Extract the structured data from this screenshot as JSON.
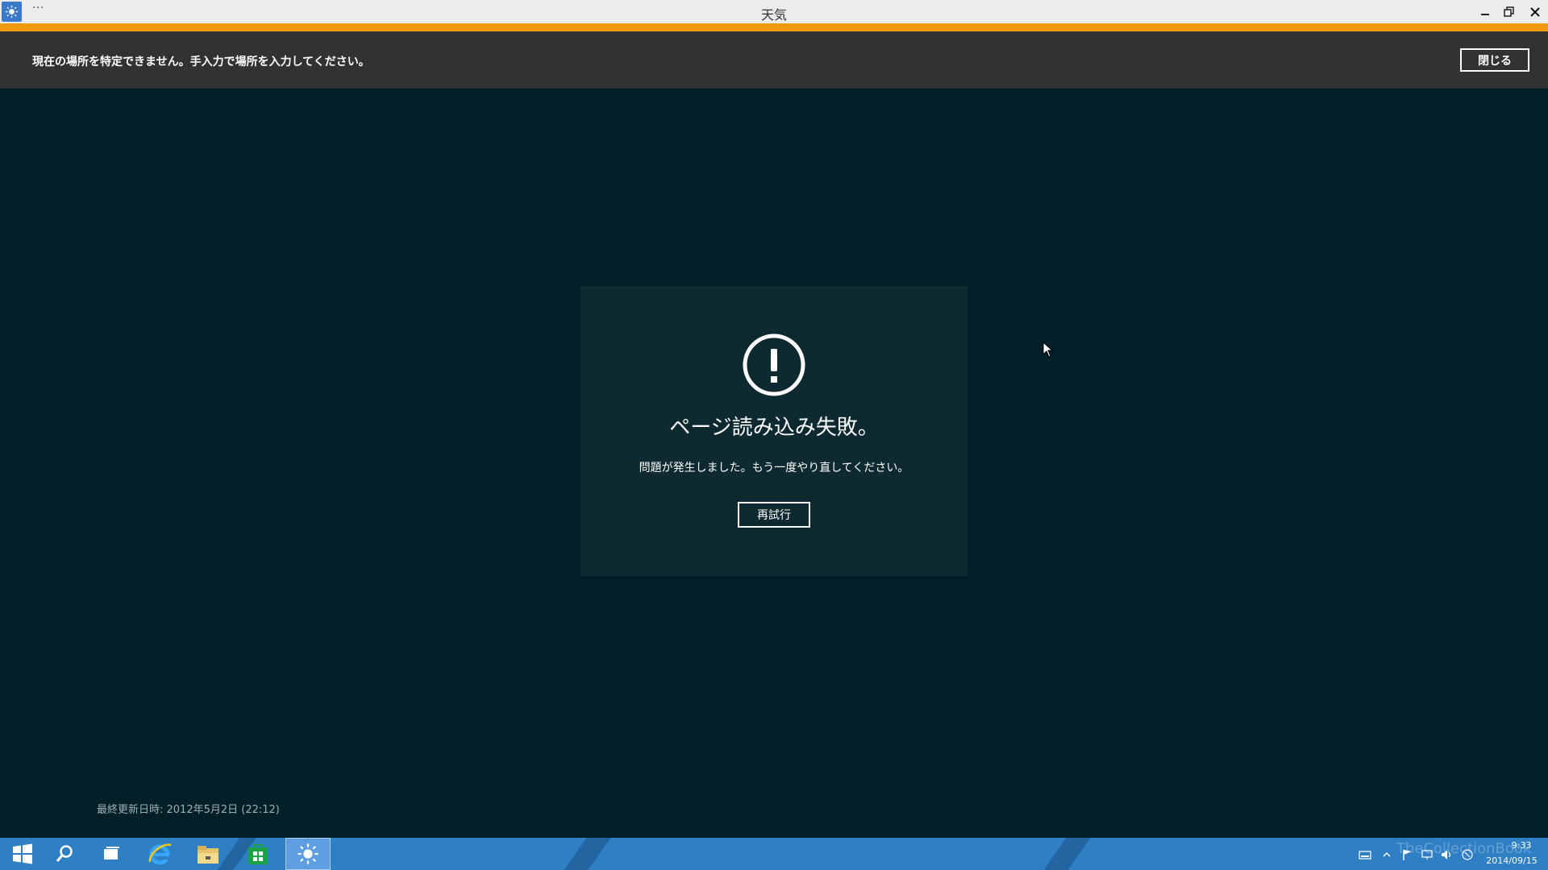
{
  "window": {
    "title": "天気",
    "menu_dots": "···"
  },
  "notification": {
    "message": "現在の場所を特定できません。手入力で場所を入力してください。",
    "close_label": "閉じる"
  },
  "error": {
    "title": "ページ読み込み失敗。",
    "message": "問題が発生しました。もう一度やり直してください。",
    "retry_label": "再試行"
  },
  "footer": {
    "last_updated": "最終更新日時: 2012年5月2日 (22:12)"
  },
  "taskbar": {
    "time": "9:33",
    "date": "2014/09/15",
    "watermark": "TheCollectionBook"
  },
  "colors": {
    "accent": "#f0990a",
    "background": "#001f26",
    "panel": "#0d2a31",
    "taskbar": "#2f7fc4"
  }
}
